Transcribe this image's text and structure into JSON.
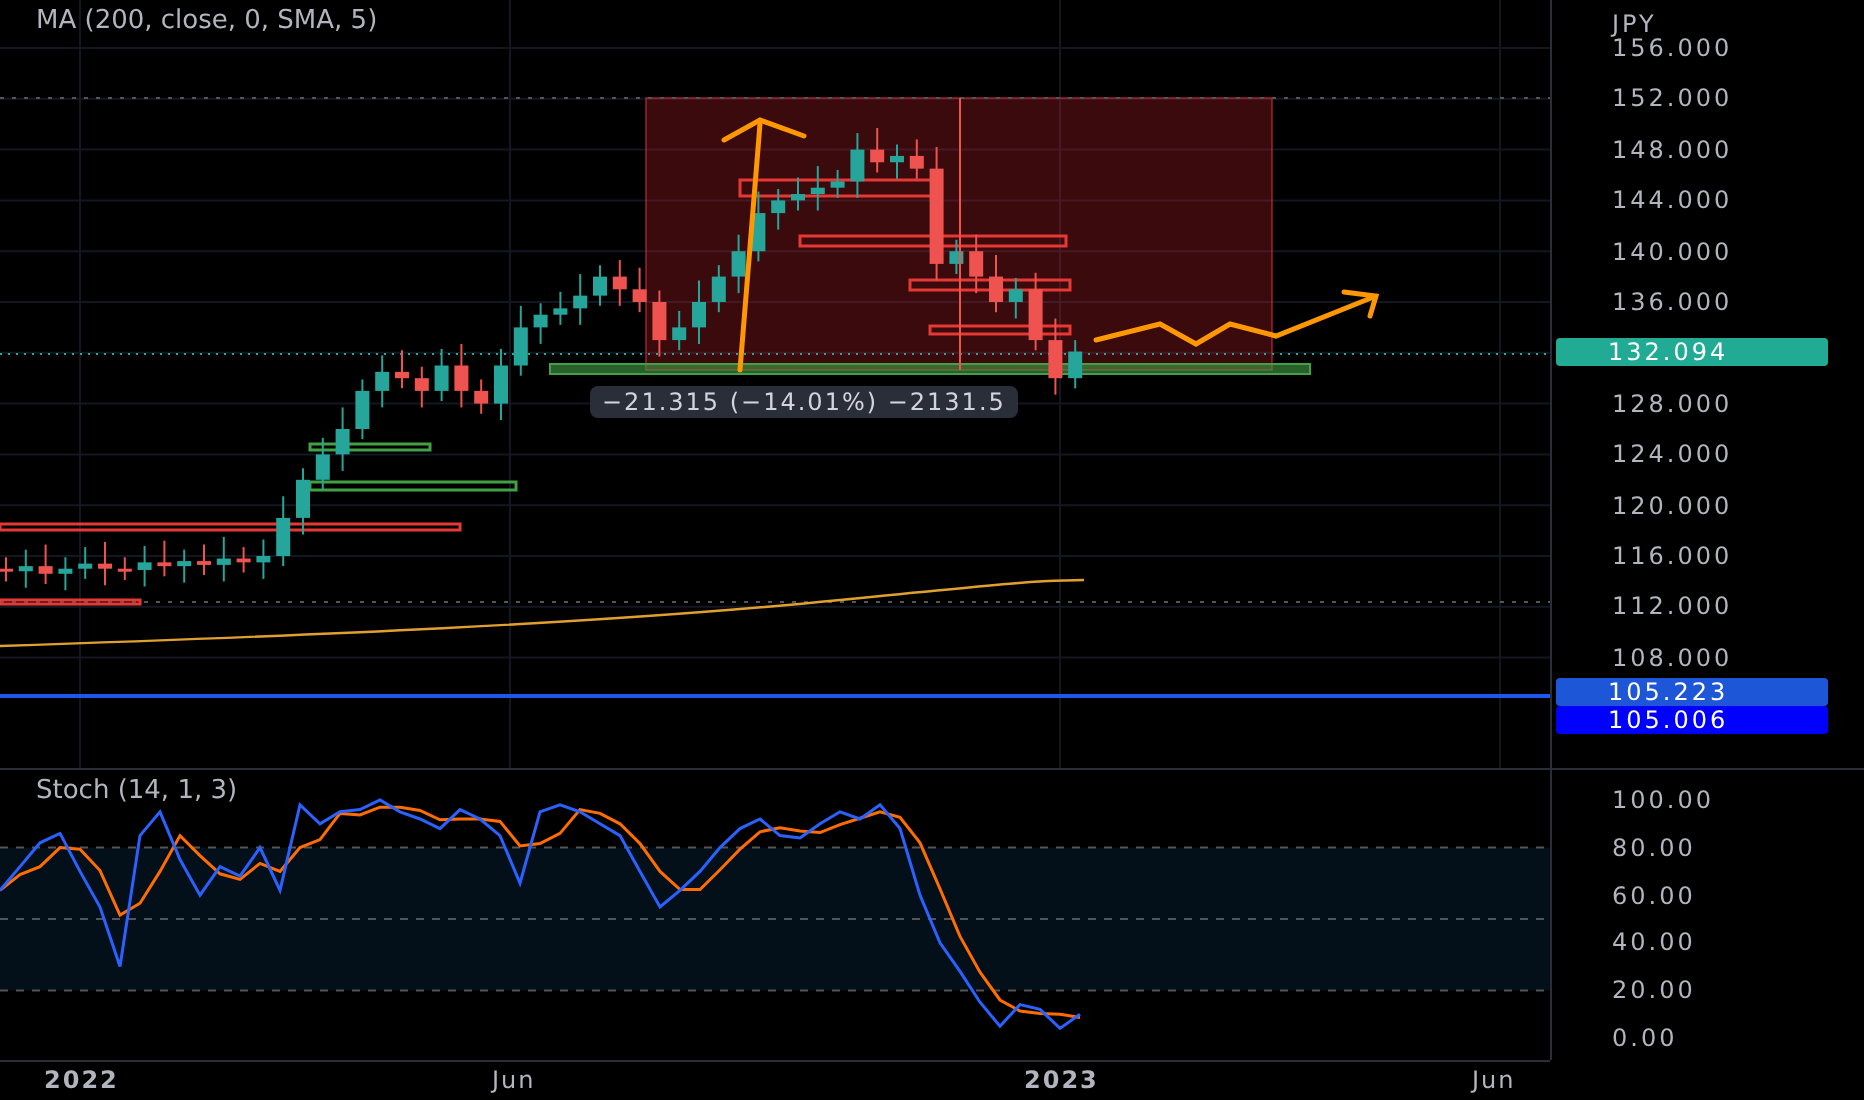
{
  "indicator_legend": {
    "label": "MA (200, close, 0, SMA, 5)"
  },
  "measure_label": "−21.315 (−14.01%) −2131.5",
  "price_axis": {
    "unit": "JPY",
    "ticks": [
      "156.000",
      "152.000",
      "148.000",
      "144.000",
      "140.000",
      "136.000",
      "128.000",
      "124.000",
      "120.000",
      "116.000",
      "112.000",
      "108.000"
    ]
  },
  "price_labels": [
    {
      "text": "132.094",
      "color": "#22ab94"
    },
    {
      "text": "105.223",
      "color": "#1e56d8"
    },
    {
      "text": "105.006",
      "color": "#0000ff"
    }
  ],
  "oscillator": {
    "legend": "Stoch (14, 1, 3)",
    "ticks": [
      "100.00",
      "80.00",
      "60.00",
      "40.00",
      "20.00",
      "0.00"
    ]
  },
  "time_axis": [
    {
      "label": "2022",
      "kind": "year"
    },
    {
      "label": "Jun",
      "kind": "month"
    },
    {
      "label": "2023",
      "kind": "year"
    },
    {
      "label": "Jun",
      "kind": "month"
    }
  ]
}
